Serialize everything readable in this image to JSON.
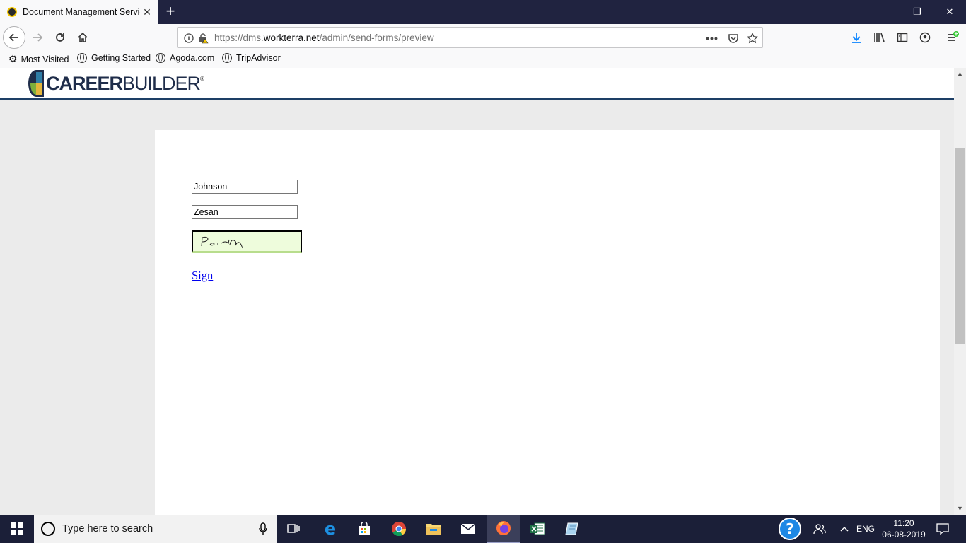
{
  "browser": {
    "tab_title": "Document Management Servic",
    "tab_close": "✕",
    "new_tab": "+",
    "window_controls": {
      "minimize": "—",
      "restore": "❐",
      "close": "✕"
    },
    "url_prefix": "https://dms.",
    "url_host": "workterra.net",
    "url_path": "/admin/send-forms/preview",
    "bookmarks": [
      {
        "label": "Most Visited",
        "icon": "gear-icon"
      },
      {
        "label": "Getting Started",
        "icon": "globe-icon"
      },
      {
        "label": "Agoda.com",
        "icon": "globe-icon"
      },
      {
        "label": "TripAdvisor",
        "icon": "globe-icon"
      }
    ]
  },
  "page": {
    "logo_career": "CAREER",
    "logo_builder": "BUILDER",
    "logo_tm": "®",
    "last_name_value": "Johnson",
    "first_name_value": "Zesan",
    "signature_text": "Ps·-pn",
    "sign_link": "Sign"
  },
  "taskbar": {
    "search_placeholder": "Type here to search",
    "language": "ENG",
    "time": "11:20",
    "date": "06-08-2019"
  }
}
